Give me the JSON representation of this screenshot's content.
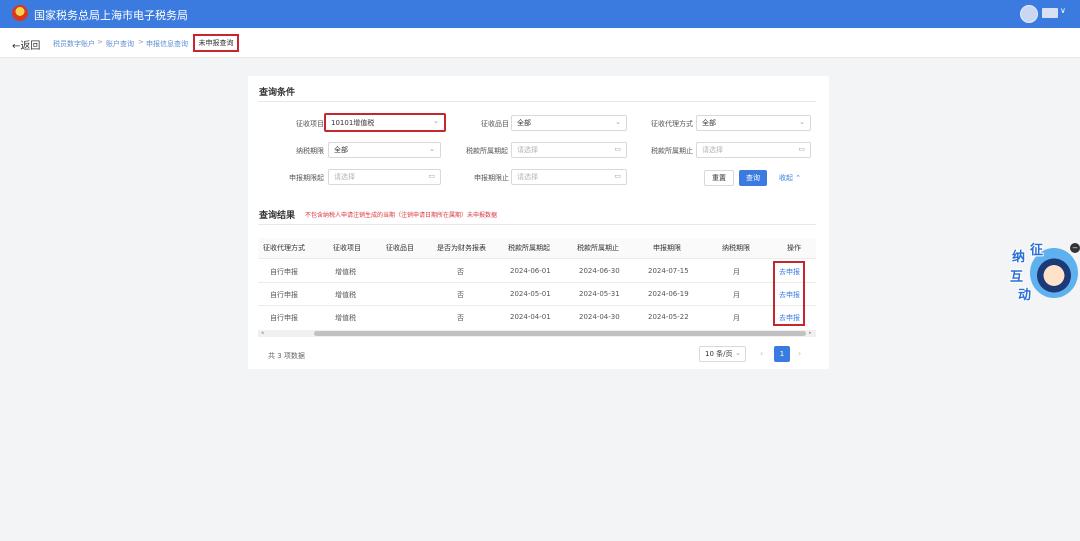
{
  "header": {
    "site_title": "国家税务总局上海市电子税务局",
    "user_caret": "∨"
  },
  "breadcrumb": {
    "back_label": "←返回",
    "items": [
      "税员数字账户",
      "账户查询",
      "申报信息查询"
    ],
    "separator": ">",
    "current": "未申报查询"
  },
  "query": {
    "title": "查询条件",
    "fields": {
      "levy_item": {
        "label": "征收项目",
        "value": "10101增值税",
        "icon": "chevron-down-icon"
      },
      "levy_subitem": {
        "label": "征收品目",
        "value": "全部",
        "icon": "chevron-down-icon"
      },
      "agent_mode": {
        "label": "征收代理方式",
        "value": "全部",
        "icon": "chevron-down-icon"
      },
      "tax_period": {
        "label": "纳税期限",
        "value": "全部",
        "icon": "chevron-down-icon"
      },
      "period_start": {
        "label": "税款所属期起",
        "placeholder": "请选择",
        "icon": "calendar-icon"
      },
      "period_end": {
        "label": "税款所属期止",
        "placeholder": "请选择",
        "icon": "calendar-icon"
      },
      "deadline_start": {
        "label": "申报期限起",
        "placeholder": "请选择",
        "icon": "calendar-icon"
      },
      "deadline_end": {
        "label": "申报期限止",
        "placeholder": "请选择",
        "icon": "calendar-icon"
      }
    },
    "reset_label": "重置",
    "query_label": "查询",
    "collapse_label": "收起 ⌃"
  },
  "results": {
    "title": "查询结果",
    "notice": "不包含纳税人申请注销生成的当期（注销申请日期所在属期）未申报数据",
    "columns": [
      "征收代理方式",
      "征收项目",
      "征收品目",
      "是否为财务报表",
      "税款所属期起",
      "税款所属期止",
      "申报期限",
      "纳税期限",
      "操作"
    ],
    "rows": [
      [
        "自行申报",
        "增值税",
        "",
        "否",
        "2024-06-01",
        "2024-06-30",
        "2024-07-15",
        "月",
        "去申报"
      ],
      [
        "自行申报",
        "增值税",
        "",
        "否",
        "2024-05-01",
        "2024-05-31",
        "2024-06-19",
        "月",
        "去申报"
      ],
      [
        "自行申报",
        "增值税",
        "",
        "否",
        "2024-04-01",
        "2024-04-30",
        "2024-05-22",
        "月",
        "去申报"
      ]
    ],
    "total": "共 3 项数据",
    "page_size": "10 条/页",
    "current_page": "1"
  },
  "float_widget": {
    "chars": [
      "征",
      "纳",
      "互",
      "动"
    ],
    "icon": "customer-service-icon"
  },
  "colors": {
    "brand": "#3b7be0",
    "highlight": "#c6262e",
    "notice": "#d9363e"
  }
}
